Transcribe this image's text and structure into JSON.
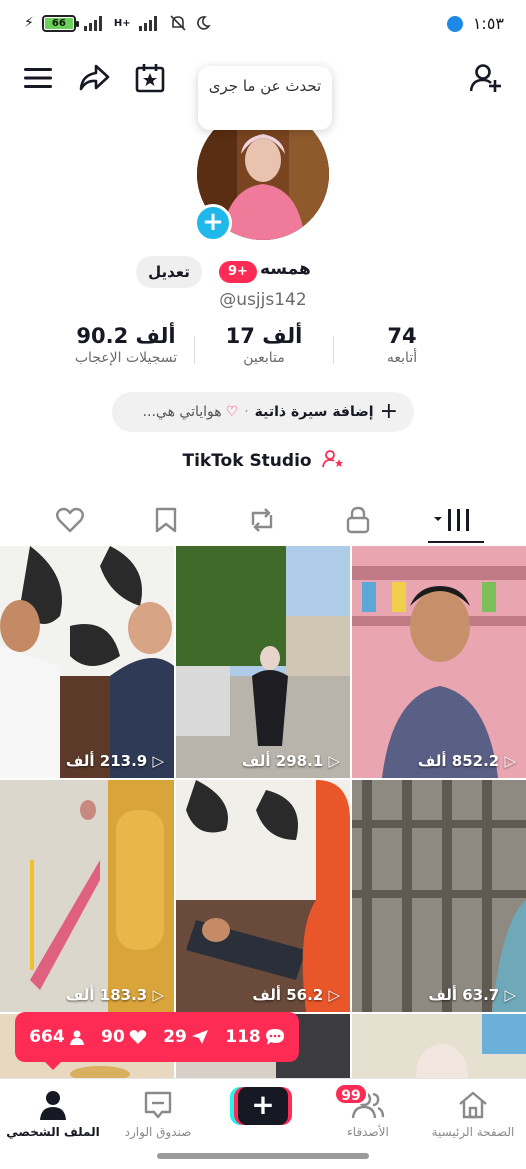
{
  "status_bar": {
    "battery": "66",
    "time": "١:٥٣",
    "network": "H+"
  },
  "profile": {
    "bubble_text": "تحدث عن ما جرى",
    "display_name": "همسه",
    "name_badge": "9+",
    "edit_label": "تعديل",
    "username": "@usjjs142"
  },
  "stats": {
    "following": {
      "value": "74",
      "label": "أتابعه"
    },
    "followers": {
      "value": "17 ألف",
      "label": "متابعين"
    },
    "likes": {
      "value": "90.2 ألف",
      "label": "تسجيلات الإعجاب"
    }
  },
  "bio": {
    "add_bio": "إضافة سيرة ذاتية",
    "separator": "·",
    "hobbies": "هواياتي هي..."
  },
  "studio_label": "TikTok Studio",
  "videos": [
    {
      "views": "213.9 ألف"
    },
    {
      "views": "298.1 ألف"
    },
    {
      "views": "852.2 ألف"
    },
    {
      "views": "183.3 ألف"
    },
    {
      "views": "56.2 ألف"
    },
    {
      "views": "63.7 ألف"
    }
  ],
  "notifications": {
    "comments": "118",
    "shares": "29",
    "likes": "90",
    "followers": "664"
  },
  "bottom_nav": {
    "home": "الصفحة الرئيسية",
    "friends": "الأصدقاء",
    "friends_badge": "99",
    "inbox": "صندوق الوارد",
    "profile": "الملف الشخصي"
  },
  "colors": {
    "accent": "#fe2c55",
    "cyan": "#25f4ee",
    "dark": "#161823"
  }
}
